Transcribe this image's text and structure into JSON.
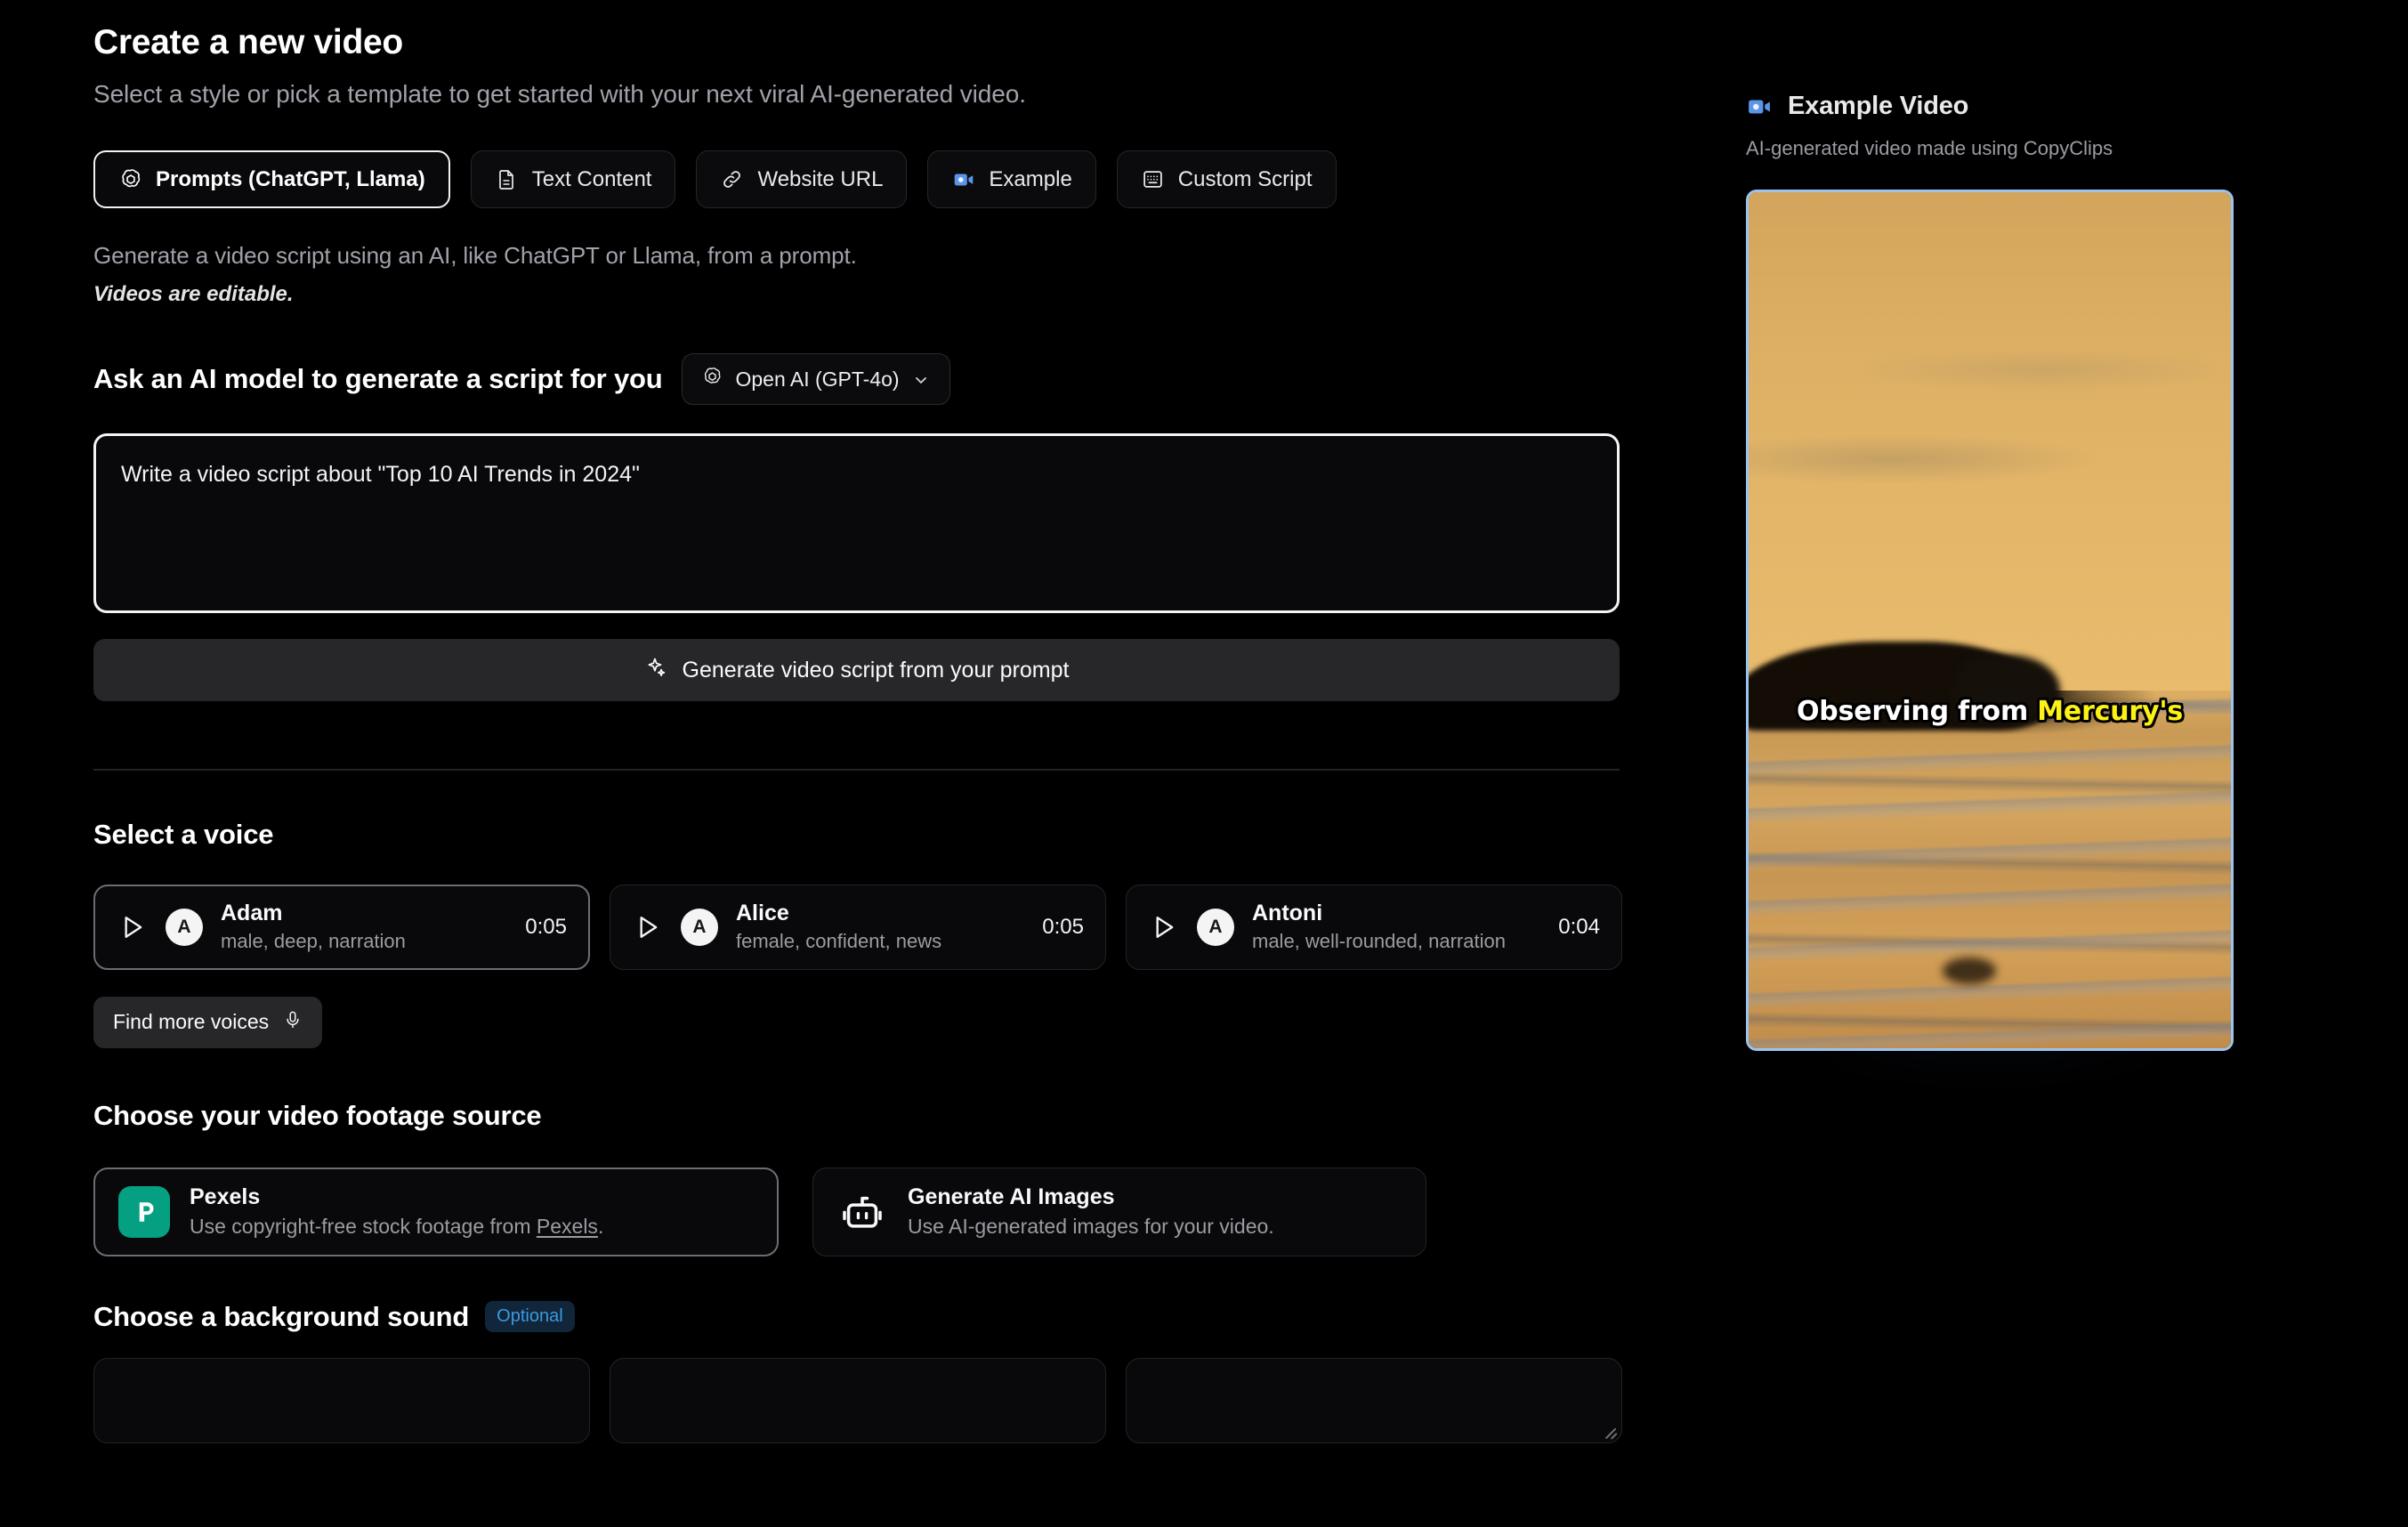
{
  "header": {
    "title": "Create a new video",
    "subtitle": "Select a style or pick a template to get started with your next viral AI-generated video."
  },
  "tabs": [
    {
      "label": "Prompts (ChatGPT, Llama)",
      "icon": "openai-icon",
      "selected": true
    },
    {
      "label": "Text Content",
      "icon": "document-icon",
      "selected": false
    },
    {
      "label": "Website URL",
      "icon": "link-icon",
      "selected": false
    },
    {
      "label": "Example",
      "icon": "video-camera-icon",
      "selected": false
    },
    {
      "label": "Custom Script",
      "icon": "keyboard-icon",
      "selected": false
    }
  ],
  "prompt_section": {
    "hint": "Generate a video script using an AI, like ChatGPT or Llama, from a prompt.",
    "hint_emphasis": "Videos are editable.",
    "ask_title": "Ask an AI model to generate a script for you",
    "model_value": "Open AI (GPT-4o)",
    "textarea_value": "Write a video script about \"Top 10 AI Trends in 2024\"",
    "textarea_placeholder": "Write a video script about...",
    "generate_button": "Generate video script from your prompt"
  },
  "voice_section": {
    "title": "Select a voice",
    "voices": [
      {
        "name": "Adam",
        "desc": "male, deep, narration",
        "duration": "0:05",
        "initial": "A",
        "selected": true
      },
      {
        "name": "Alice",
        "desc": "female, confident, news",
        "duration": "0:05",
        "initial": "A",
        "selected": false
      },
      {
        "name": "Antoni",
        "desc": "male, well-rounded, narration",
        "duration": "0:04",
        "initial": "A",
        "selected": false
      }
    ],
    "find_more_label": "Find more voices"
  },
  "footage_section": {
    "title": "Choose your video footage source",
    "options": [
      {
        "name": "Pexels",
        "desc_before": "Use copyright-free stock footage from ",
        "desc_link": "Pexels",
        "desc_after": ".",
        "selected": true,
        "logo_color": "#05a081"
      },
      {
        "name": "Generate AI Images",
        "desc_before": "Use AI-generated images for your video.",
        "desc_link": "",
        "desc_after": "",
        "selected": false
      }
    ]
  },
  "background_sound_section": {
    "title": "Choose a background sound",
    "badge": "Optional",
    "badge_color": "#3b9ae1"
  },
  "example_panel": {
    "title": "Example Video",
    "subtitle": "AI-generated video made using CopyClips",
    "caption_white": "Observing from",
    "caption_highlight": "Mercury's",
    "caption_highlight_color": "#fdf215",
    "frame_border_color": "#9cc3ef"
  }
}
